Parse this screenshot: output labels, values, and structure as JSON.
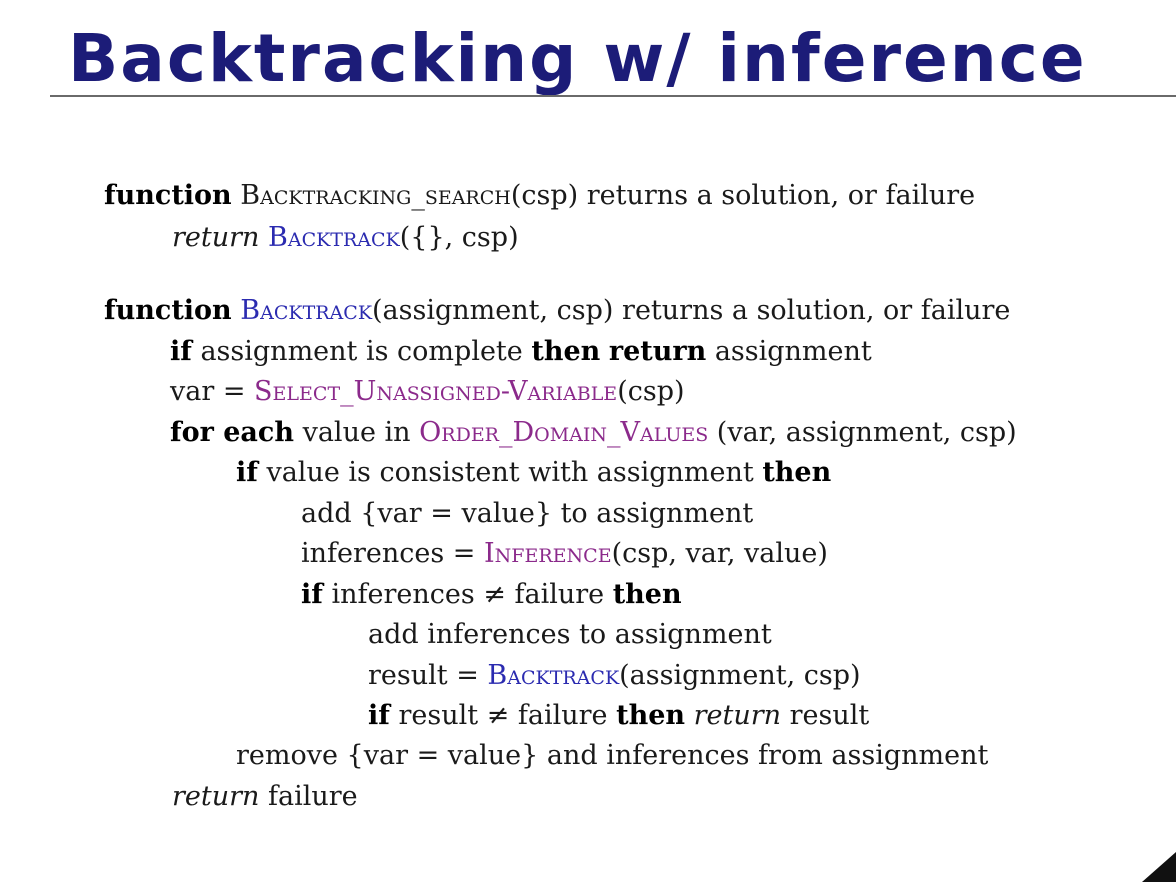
{
  "title": "Backtracking w/ inference",
  "algorithm": {
    "line1": {
      "kw_function": "function",
      "name": "Backtracking_search",
      "paren": "(csp)",
      "returns": " returns a solution, or failure"
    },
    "line2": {
      "kw_return": "return",
      "name": "Backtrack",
      "args": "({}, csp)"
    },
    "line3": {
      "kw_function": "function",
      "name": "Backtrack",
      "paren": "(assignment, csp)",
      "returns": " returns a solution, or failure"
    },
    "line4": {
      "kw_if": "if",
      "text1": " assignment is complete ",
      "kw_then": "then",
      "kw_return": "return",
      "text2": " assignment"
    },
    "line5": {
      "text1": "var = ",
      "name": "Select_Unassigned-Variable",
      "args": "(csp)"
    },
    "line6": {
      "kw_for": "for each",
      "text1": " value in ",
      "name": "Order_Domain_Values",
      "args": " (var, assignment, csp)"
    },
    "line7": {
      "kw_if": "if",
      "text1": " value is consistent with assignment ",
      "kw_then": "then"
    },
    "line8": {
      "text": "add {var = value} to assignment"
    },
    "line9": {
      "text1": "inferences = ",
      "name": "Inference",
      "args": "(csp, var, value)"
    },
    "line10": {
      "kw_if": "if",
      "text1": " inferences ≠ failure ",
      "kw_then": "then"
    },
    "line11": {
      "text": "add inferences to assignment"
    },
    "line12": {
      "text1": "result = ",
      "name": "Backtrack",
      "args": "(assignment, csp)"
    },
    "line13": {
      "kw_if": "if",
      "text1": " result ≠ failure ",
      "kw_then": "then",
      "kw_return": "return",
      "text2": " result"
    },
    "line14": {
      "text": "remove {var = value} and inferences from assignment"
    },
    "line15": {
      "kw_return": "return",
      "text1": " failure"
    }
  },
  "colors": {
    "title": "#1c1c78",
    "function_name_blue": "#2b2bb0",
    "function_name_purple": "#8b2a8b",
    "rule": "#6a6a6a"
  }
}
